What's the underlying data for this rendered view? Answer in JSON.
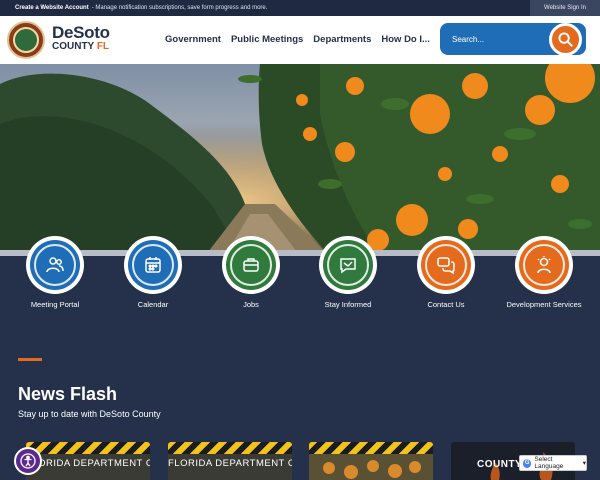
{
  "topbar": {
    "create_account": "Create a Website Account",
    "message": "- Manage notification subscriptions, save form progress and more.",
    "sign_in": "Website Sign In"
  },
  "logo": {
    "line1": "DeSoto",
    "line2_county": "COUNTY",
    "line2_state": "FL"
  },
  "nav": {
    "items": [
      "Government",
      "Public Meetings",
      "Departments",
      "How Do I..."
    ]
  },
  "search": {
    "placeholder": "Search..."
  },
  "quick_links": [
    {
      "label": "Meeting Portal",
      "color": "#1f6db6",
      "icon": "people-icon"
    },
    {
      "label": "Calendar",
      "color": "#1f6db6",
      "icon": "calendar-icon"
    },
    {
      "label": "Jobs",
      "color": "#2f7a3c",
      "icon": "briefcase-icon"
    },
    {
      "label": "Stay Informed",
      "color": "#2f7a3c",
      "icon": "message-icon"
    },
    {
      "label": "Contact Us",
      "color": "#e46a1e",
      "icon": "chat-bubbles-icon"
    },
    {
      "label": "Development Services",
      "color": "#e46a1e",
      "icon": "idea-person-icon"
    }
  ],
  "news": {
    "title": "News Flash",
    "subtitle": "Stay up to date with DeSoto County",
    "cards": [
      {
        "title": "FLORIDA DEPARTMENT OF TRANSPORTATION"
      },
      {
        "title": "FLORIDA DEPARTMENT OF TRANSPORTATION"
      },
      {
        "title": ""
      },
      {
        "title": "COUNTY"
      }
    ]
  },
  "language": {
    "label": "Select Language"
  },
  "colors": {
    "navy": "#25304a",
    "accent_orange": "#e46a1e",
    "accent_blue": "#1f6db6",
    "accent_green": "#2f7a3c"
  }
}
